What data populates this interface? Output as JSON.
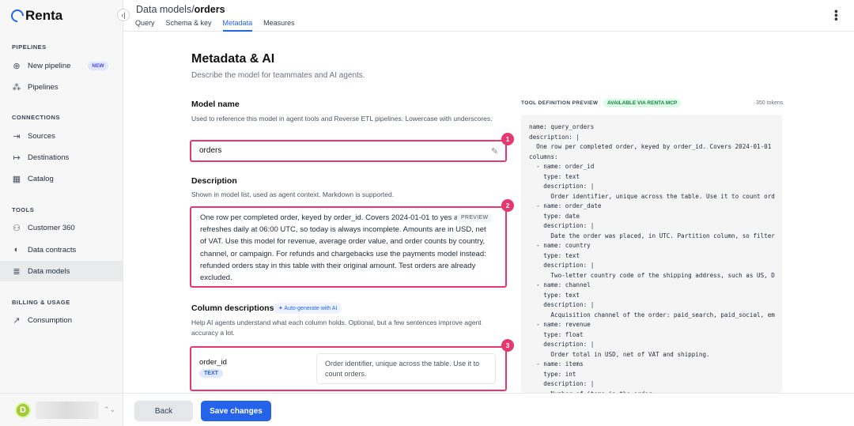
{
  "app": {
    "name": "Renta"
  },
  "sidebar": {
    "sections": [
      {
        "title": "PIPELINES"
      },
      {
        "title": "CONNECTIONS"
      },
      {
        "title": "TOOLS"
      },
      {
        "title": "BILLING & USAGE"
      }
    ],
    "items": [
      {
        "label": "New pipeline",
        "badge": "NEW",
        "icon": "plus-circle-icon"
      },
      {
        "label": "Pipelines",
        "icon": "pipelines-icon"
      },
      {
        "label": "Sources",
        "icon": "sources-icon"
      },
      {
        "label": "Destinations",
        "icon": "destinations-icon"
      },
      {
        "label": "Catalog",
        "icon": "catalog-icon"
      },
      {
        "label": "Customer 360",
        "icon": "person-icon"
      },
      {
        "label": "Data contracts",
        "icon": "shield-icon"
      },
      {
        "label": "Data models",
        "icon": "database-icon",
        "active": true
      },
      {
        "label": "Consumption",
        "icon": "chart-icon"
      }
    ],
    "user": {
      "initial": "D"
    }
  },
  "header": {
    "breadcrumb_parent": "Data models",
    "separator": "/",
    "breadcrumb_current": "orders",
    "tabs": [
      {
        "label": "Query"
      },
      {
        "label": "Schema & key"
      },
      {
        "label": "Metadata",
        "active": true
      },
      {
        "label": "Measures"
      }
    ]
  },
  "page": {
    "title": "Metadata & AI",
    "subtitle": "Describe the model for teammates and AI agents."
  },
  "model_name": {
    "label": "Model name",
    "help": "Used to reference this model in agent tools and Reverse ETL pipelines. Lowercase with underscores.",
    "value": "orders",
    "marker": "1"
  },
  "description": {
    "label": "Description",
    "help": "Shown in model list, used as agent context. Markdown is supported.",
    "value": "One row per completed order, keyed by order_id. Covers 2024-01-01 to yes and refreshes daily at 06:00 UTC, so today is always incomplete. Amounts are in USD, net of VAT. Use this model for revenue, average order value, and order counts by country, channel, or campaign. For refunds and chargebacks use the payments model instead: refunded orders stay in this table with their original amount. Test orders are already excluded.",
    "preview_label": "PREVIEW",
    "marker": "2"
  },
  "columns": {
    "label": "Column descriptions",
    "autogen_label": "✦ Auto-generate with AI",
    "help": "Help AI agents understand what each column holds. Optional, but a few sentences improve agent accuracy a lot.",
    "rows": [
      {
        "name": "order_id",
        "type": "TEXT",
        "description": "Order identifier, unique across the table. Use it to count orders."
      }
    ],
    "marker": "3"
  },
  "tool_definition": {
    "label": "TOOL DEFINITION PREVIEW",
    "badge": "AVAILABLE VIA RENTA MCP",
    "tokens": "350 tokens",
    "code": "name: query_orders\ndescription: |\n  One row per completed order, keyed by order_id. Covers 2024-01-01\ncolumns:\n  - name: order_id\n    type: text\n    description: |\n      Order identifier, unique across the table. Use it to count ord\n  - name: order_date\n    type: date\n    description: |\n      Date the order was placed, in UTC. Partition column, so filter\n  - name: country\n    type: text\n    description: |\n      Two-letter country code of the shipping address, such as US, D\n  - name: channel\n    type: text\n    description: |\n      Acquisition channel of the order: paid_search, paid_social, em\n  - name: revenue\n    type: float\n    description: |\n      Order total in USD, net of VAT and shipping.\n  - name: items\n    type: int\n    description: |\n      Number of items in the order"
  },
  "footer": {
    "back_label": "Back",
    "save_label": "Save changes"
  },
  "colors": {
    "accent": "#2563eb",
    "marker": "#e6386f"
  }
}
